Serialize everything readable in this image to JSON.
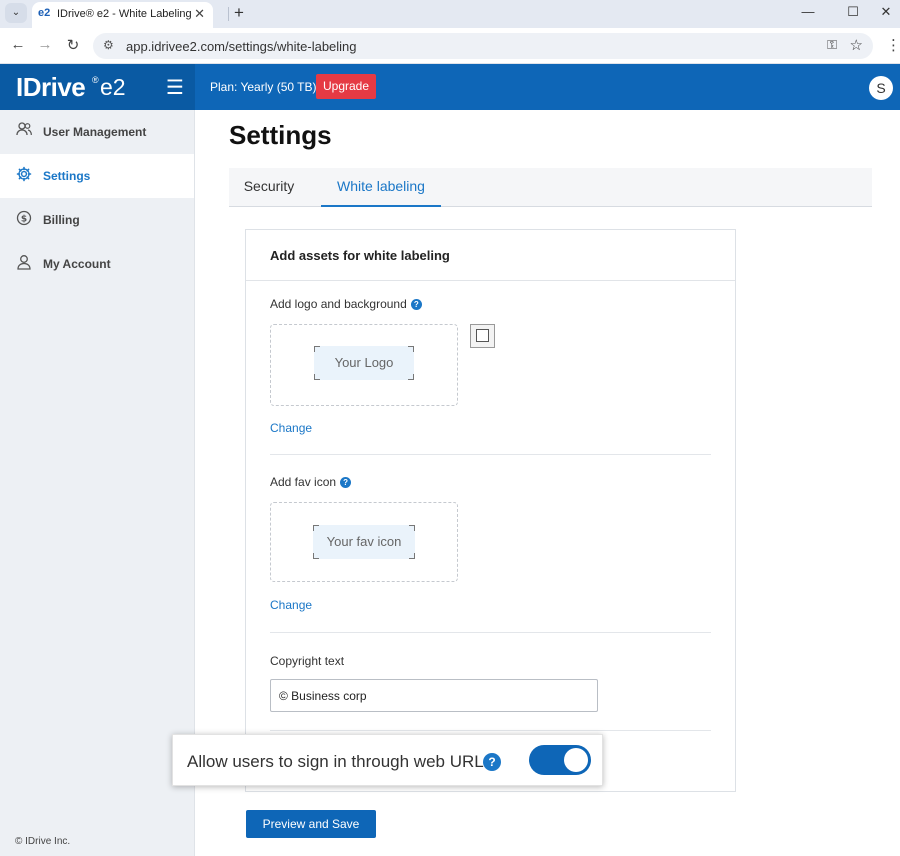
{
  "browser": {
    "tab_favicon": "e2",
    "tab_title": "IDrive® e2 - White Labeling",
    "url": "app.idrivee2.com/settings/white-labeling",
    "icons": [
      "chevron-down-icon",
      "close-icon",
      "plus-icon",
      "minimize-icon",
      "maximize-icon",
      "close-window-icon",
      "back-icon",
      "forward-icon",
      "reload-icon",
      "site-settings-icon",
      "password-key-icon",
      "star-icon",
      "kebab-menu-icon"
    ]
  },
  "header": {
    "logo_text": "IDrive",
    "logo_reg": "®",
    "logo_suffix": "e2",
    "plan": "Plan: Yearly (50 TB)",
    "upgrade_label": "Upgrade",
    "avatar_initial": "S",
    "brand_color": "#0e66b7",
    "upgrade_color": "#e53a44"
  },
  "sidebar": {
    "items": [
      {
        "label": "User Management",
        "icon": "users-icon",
        "active": false
      },
      {
        "label": "Settings",
        "icon": "gear-icon",
        "active": true
      },
      {
        "label": "Billing",
        "icon": "dollar-icon",
        "active": false
      },
      {
        "label": "My Account",
        "icon": "person-icon",
        "active": false
      }
    ],
    "footer": "© IDrive Inc."
  },
  "main": {
    "title": "Settings",
    "tabs": [
      {
        "label": "Security",
        "active": false
      },
      {
        "label": "White labeling",
        "active": true
      }
    ],
    "card": {
      "title": "Add assets for white labeling",
      "logo_section_label": "Add logo and background",
      "logo_placeholder": "Your Logo",
      "change_label": "Change",
      "fav_section_label": "Add fav icon",
      "fav_placeholder": "Your fav icon",
      "copyright_label": "Copyright text",
      "copyright_value": "© Business corp"
    },
    "toggle": {
      "label": "Allow users to sign in through web URL",
      "help": "?",
      "on": true
    },
    "save_label": "Preview and Save"
  }
}
